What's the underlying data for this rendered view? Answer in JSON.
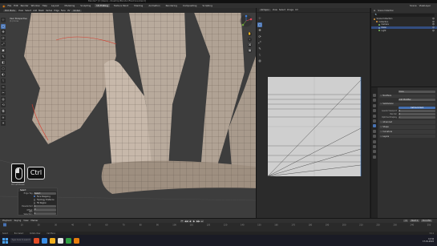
{
  "window": {
    "title": "Blender* [C:\\Users\\...\\Desktop\\Blender\\FlexCone.blend]"
  },
  "menubar": {
    "items": [
      "File",
      "Edit",
      "Render",
      "Window",
      "Help"
    ],
    "workspaces": [
      "Layout",
      "Modeling",
      "Sculpting",
      "UV Editing",
      "Texture Paint",
      "Shading",
      "Animation",
      "Rendering",
      "Compositing",
      "Scripting"
    ],
    "active_workspace": "UV Editing",
    "scene": "Scene",
    "view_layer": "ViewLayer"
  },
  "viewport": {
    "header": {
      "mode": "Edit Mode",
      "menus": [
        "View",
        "Select",
        "Add",
        "Mesh",
        "Vertex",
        "Edge",
        "Face",
        "UV"
      ],
      "orientation": "Global"
    },
    "info_line1": "User Perspective",
    "info_line2": "(1) Cone",
    "tools": [
      "⊹",
      "▢",
      "✥",
      "⟳",
      "⤢",
      "▣",
      "✎",
      "◧",
      "⬡",
      "◐",
      "⌇",
      "⤳",
      "✂",
      "◍",
      "⟲",
      "⧉",
      "⟡",
      "✦"
    ],
    "nav_buttons": [
      "✋",
      "⌕",
      "⌘",
      "▦"
    ],
    "colors": {
      "background": "#3d3d3d",
      "mesh": "#b8aa9c",
      "mesh_shadow": "#7d6f63",
      "seam": "#d83b2c",
      "wire": "#5b5048"
    }
  },
  "keycast": {
    "key_label": "Ctrl",
    "caption": "Ctrl  Left Mouse"
  },
  "operator_panel": {
    "title": "Select",
    "rows": [
      {
        "label": "Edge Tag",
        "type": "field",
        "value": "Select"
      },
      {
        "label": "",
        "type": "check",
        "checked": true,
        "value": "Face Stepping"
      },
      {
        "label": "",
        "type": "check",
        "checked": false,
        "value": "Topology Distance"
      },
      {
        "label": "",
        "type": "check",
        "checked": false,
        "value": "Fill Region"
      },
      {
        "label": "Deselected",
        "type": "field",
        "value": "1"
      },
      {
        "label": "Offset",
        "type": "field",
        "value": "0"
      },
      {
        "label": "Nth Selection",
        "type": "field",
        "value": "1"
      }
    ]
  },
  "image_editor": {
    "header": {
      "menus": [
        "View",
        "Select",
        "Image",
        "UV"
      ],
      "sync": "UV Sync"
    },
    "tools": [
      "⊹",
      "▢",
      "✥",
      "⟳",
      "⤢",
      "✎",
      "⌇",
      "◍"
    ],
    "colors": {
      "background": "#2b2b2b",
      "uv_grid": "#cfcfcf"
    }
  },
  "outliner": {
    "header": "Scene Collection",
    "search_placeholder": "🔍",
    "rows": [
      {
        "indent": 0,
        "label": "Scene Collection",
        "kind": "coll",
        "selected": false
      },
      {
        "indent": 1,
        "label": "Collection",
        "kind": "coll",
        "selected": false
      },
      {
        "indent": 2,
        "label": "Camera",
        "kind": "green",
        "selected": false
      },
      {
        "indent": 2,
        "label": "Cone",
        "kind": "mesh",
        "selected": true
      },
      {
        "indent": 2,
        "label": "Light",
        "kind": "green",
        "selected": false
      }
    ]
  },
  "properties": {
    "object_name": "Cone",
    "rows": [
      {
        "type": "row",
        "label": "",
        "value": "Cone"
      },
      {
        "type": "section",
        "label": "Modifiers"
      },
      {
        "type": "row",
        "label": "",
        "value": "Add Modifier"
      },
      {
        "type": "section",
        "label": "Subdivision"
      },
      {
        "type": "toggle",
        "label": "",
        "value": "Catmull-Clark"
      },
      {
        "type": "row",
        "label": "Levels Viewport",
        "value": "2"
      },
      {
        "type": "row",
        "label": "Render",
        "value": "2"
      },
      {
        "type": "row",
        "label": "Optimal Display",
        "value": "✓"
      },
      {
        "type": "section",
        "label": "Advanced"
      },
      {
        "type": "section",
        "label": "Shape"
      },
      {
        "type": "section",
        "label": "Curvature"
      },
      {
        "type": "section",
        "label": "Layers"
      }
    ]
  },
  "timeline": {
    "menus": [
      "Playback",
      "Keying",
      "View",
      "Marker"
    ],
    "controls": [
      "⏮",
      "◀◀",
      "◀",
      "▶",
      "▶▶",
      "⏭"
    ],
    "current_frame": "1",
    "start": "Start 1",
    "end": "End 250",
    "ticks": [
      "0",
      "10",
      "20",
      "30",
      "40",
      "50",
      "60",
      "70",
      "80",
      "90",
      "100",
      "110",
      "120",
      "130",
      "140",
      "150",
      "160",
      "170",
      "180",
      "190",
      "200",
      "210",
      "220",
      "230",
      "240",
      "250"
    ]
  },
  "statusbar": {
    "items": [
      "Select",
      "Box Select",
      "Rotate View",
      "Call Menu"
    ],
    "version": "3.0.1"
  },
  "taskbar": {
    "search_placeholder": "Type here to search",
    "apps": [
      "#e34c26",
      "#3a8ee6",
      "#f2b01e",
      "#e5e5e5",
      "#2ea043",
      "#e87d0d"
    ],
    "time": "12:34",
    "date": "17-01-2022"
  }
}
